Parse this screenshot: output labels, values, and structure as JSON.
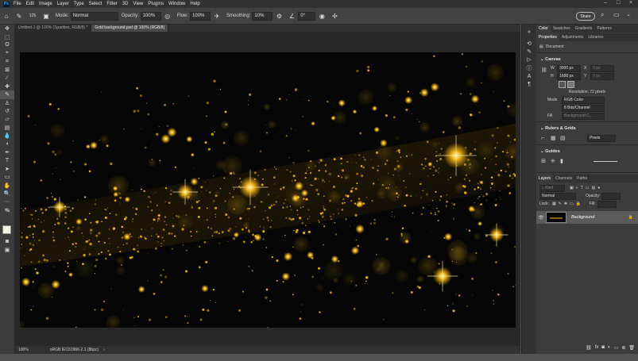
{
  "menubar": {
    "app_icon": "Ps",
    "items": [
      "File",
      "Edit",
      "Image",
      "Layer",
      "Type",
      "Select",
      "Filter",
      "3D",
      "View",
      "Plugins",
      "Window",
      "Help"
    ]
  },
  "options_bar": {
    "brush_size": "125",
    "mode_label": "Mode:",
    "mode_value": "Normal",
    "opacity_label": "Opacity:",
    "opacity_value": "100%",
    "flow_label": "Flow:",
    "flow_value": "100%",
    "smoothing_label": "Smoothing:",
    "smoothing_value": "10%",
    "angle_value": "0°",
    "share_label": "Share"
  },
  "tabs": [
    {
      "label": "Untitled-1 @ 100% (Sparkles, RGB/8) *",
      "active": false
    },
    {
      "label": "Gold background.psd @ 100% (RGB/8)",
      "active": true
    }
  ],
  "status": {
    "zoom": "100%",
    "profile": "sRGB IEC61966-2.1 (8bpc)"
  },
  "panels": {
    "top_tabs": [
      "Color",
      "Swatches",
      "Gradients",
      "Patterns"
    ],
    "mid_tabs": [
      "Properties",
      "Adjustments",
      "Libraries"
    ],
    "document_label": "Document",
    "canvas_section": "Canvas",
    "width_label": "W",
    "width_value": "3000 px",
    "height_label": "H",
    "height_value": "1688 px",
    "x_label": "X",
    "x_placeholder": "0 px",
    "y_label": "Y",
    "y_placeholder": "0 px",
    "resolution": "Resolution: 72 pixels",
    "mode_label": "Mode",
    "mode_value": "RGB Color",
    "bits_value": "8 Bits/Channel",
    "fill_label": "Fill",
    "fill_value": "Background C...",
    "rulers_section": "Rulers & Grids",
    "units_value": "Pixels",
    "guides_section": "Guides",
    "layers_tabs": [
      "Layers",
      "Channels",
      "Paths"
    ],
    "kind_placeholder": "Kind",
    "blend_value": "Normal",
    "opacity_label": "Opacity:",
    "lock_label": "Lock:",
    "fill2_label": "Fill:",
    "layer_name": "Background"
  },
  "colors": {
    "accent": "#31a8ff",
    "gold": "#ffc21a",
    "canvas_bg": "#060606"
  }
}
